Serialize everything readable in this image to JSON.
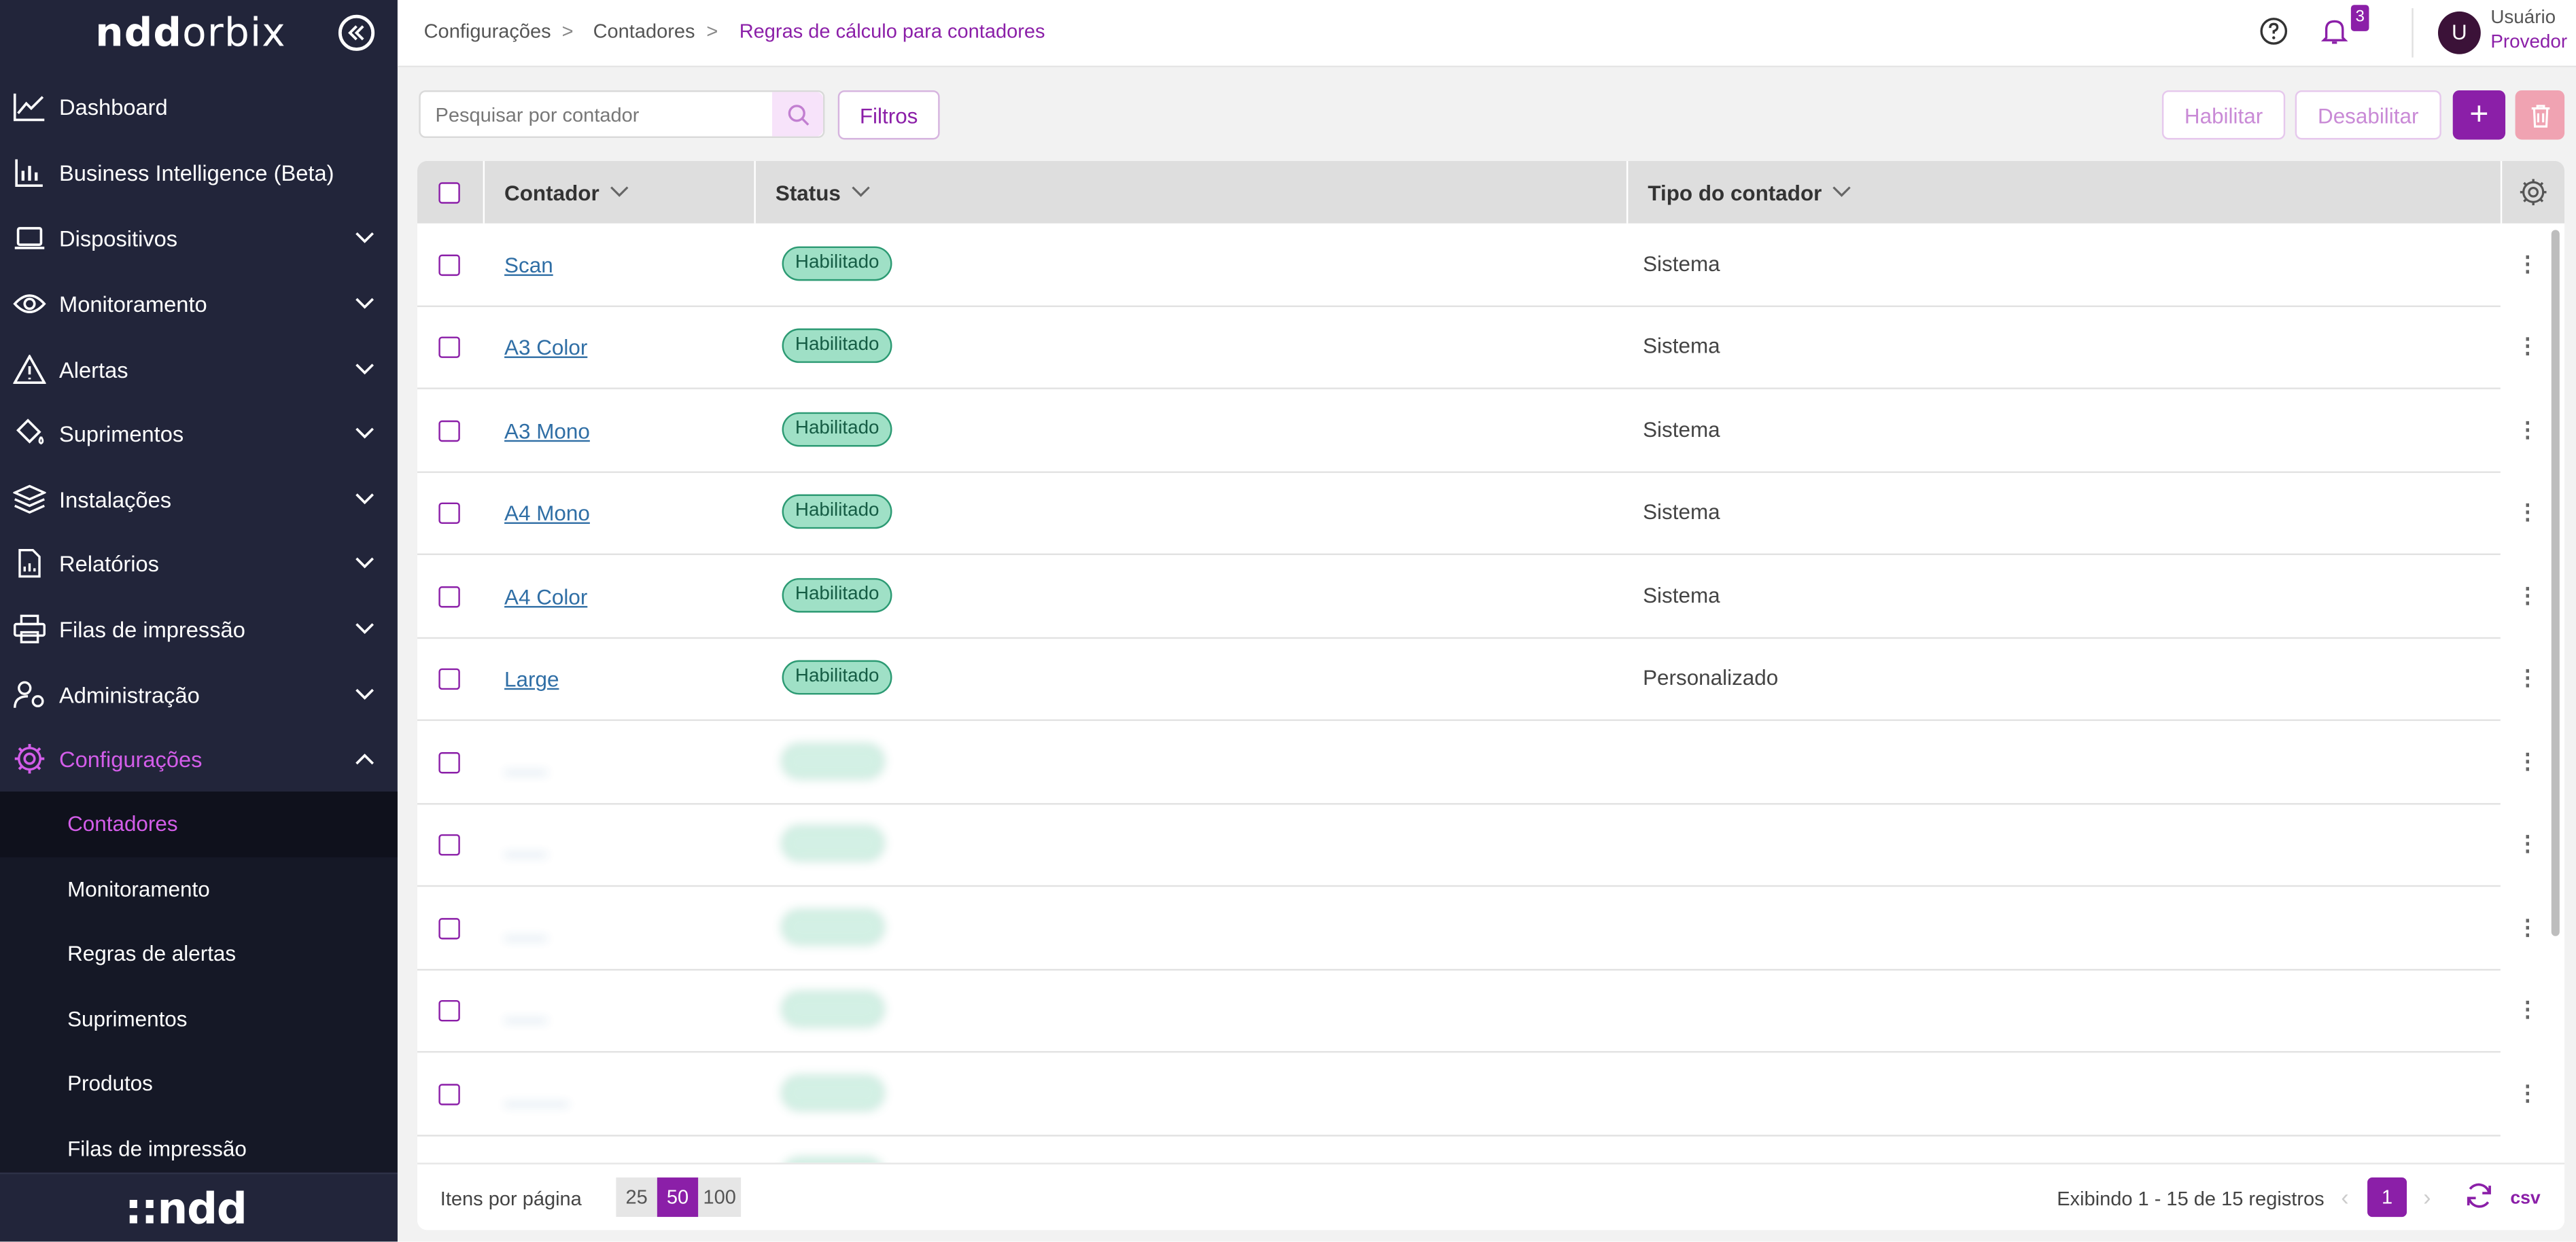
{
  "app": {
    "name_bold": "ndd",
    "name_light": "orbix",
    "footer_logo": "::ndd"
  },
  "header": {
    "breadcrumb": [
      "Configurações",
      "Contadores",
      "Regras de cálculo para contadores"
    ],
    "breadcrumb_sep": ">",
    "notifications_count": "3",
    "avatar_initial": "U",
    "user_name": "Usuário",
    "user_role": "Provedor"
  },
  "sidebar": {
    "items": [
      {
        "label": "Dashboard",
        "icon": "chart-line-icon"
      },
      {
        "label": "Business Intelligence (Beta)",
        "icon": "bar-chart-icon"
      },
      {
        "label": "Dispositivos",
        "icon": "laptop-icon"
      },
      {
        "label": "Monitoramento",
        "icon": "eye-icon"
      },
      {
        "label": "Alertas",
        "icon": "warning-icon"
      },
      {
        "label": "Suprimentos",
        "icon": "paint-bucket-icon"
      },
      {
        "label": "Instalações",
        "icon": "layers-icon"
      },
      {
        "label": "Relatórios",
        "icon": "report-icon"
      },
      {
        "label": "Filas de impressão",
        "icon": "printer-icon"
      },
      {
        "label": "Administração",
        "icon": "user-gear-icon"
      },
      {
        "label": "Configurações",
        "icon": "gear-icon"
      }
    ],
    "submenu": [
      "Contadores",
      "Monitoramento",
      "Regras de alertas",
      "Suprimentos",
      "Produtos",
      "Filas de impressão"
    ]
  },
  "toolbar": {
    "search_placeholder": "Pesquisar por contador",
    "filters_label": "Filtros",
    "enable_label": "Habilitar",
    "disable_label": "Desabilitar",
    "add_label": "+"
  },
  "table": {
    "columns": [
      "Contador",
      "Status",
      "Tipo do contador"
    ],
    "rows": [
      {
        "name": "Scan",
        "status": "Habilitado",
        "type": "Sistema"
      },
      {
        "name": "A3 Color",
        "status": "Habilitado",
        "type": "Sistema"
      },
      {
        "name": "A3 Mono",
        "status": "Habilitado",
        "type": "Sistema"
      },
      {
        "name": "A4 Mono",
        "status": "Habilitado",
        "type": "Sistema"
      },
      {
        "name": "A4 Color",
        "status": "Habilitado",
        "type": "Sistema"
      },
      {
        "name": "Large",
        "status": "Habilitado",
        "type": "Personalizado"
      }
    ],
    "blurred_row_count": 5
  },
  "footer": {
    "per_page_label": "Itens por página",
    "per_page_options": [
      "25",
      "50",
      "100"
    ],
    "per_page_selected": "50",
    "showing": "Exibindo  1 - 15 de 15 registros",
    "current_page": "1",
    "export_label": "csv"
  },
  "colors": {
    "accent": "#8b1fa8",
    "sidebar_bg": "#22253a",
    "badge_bg": "#9fe0c6",
    "link": "#2f6ea5"
  }
}
